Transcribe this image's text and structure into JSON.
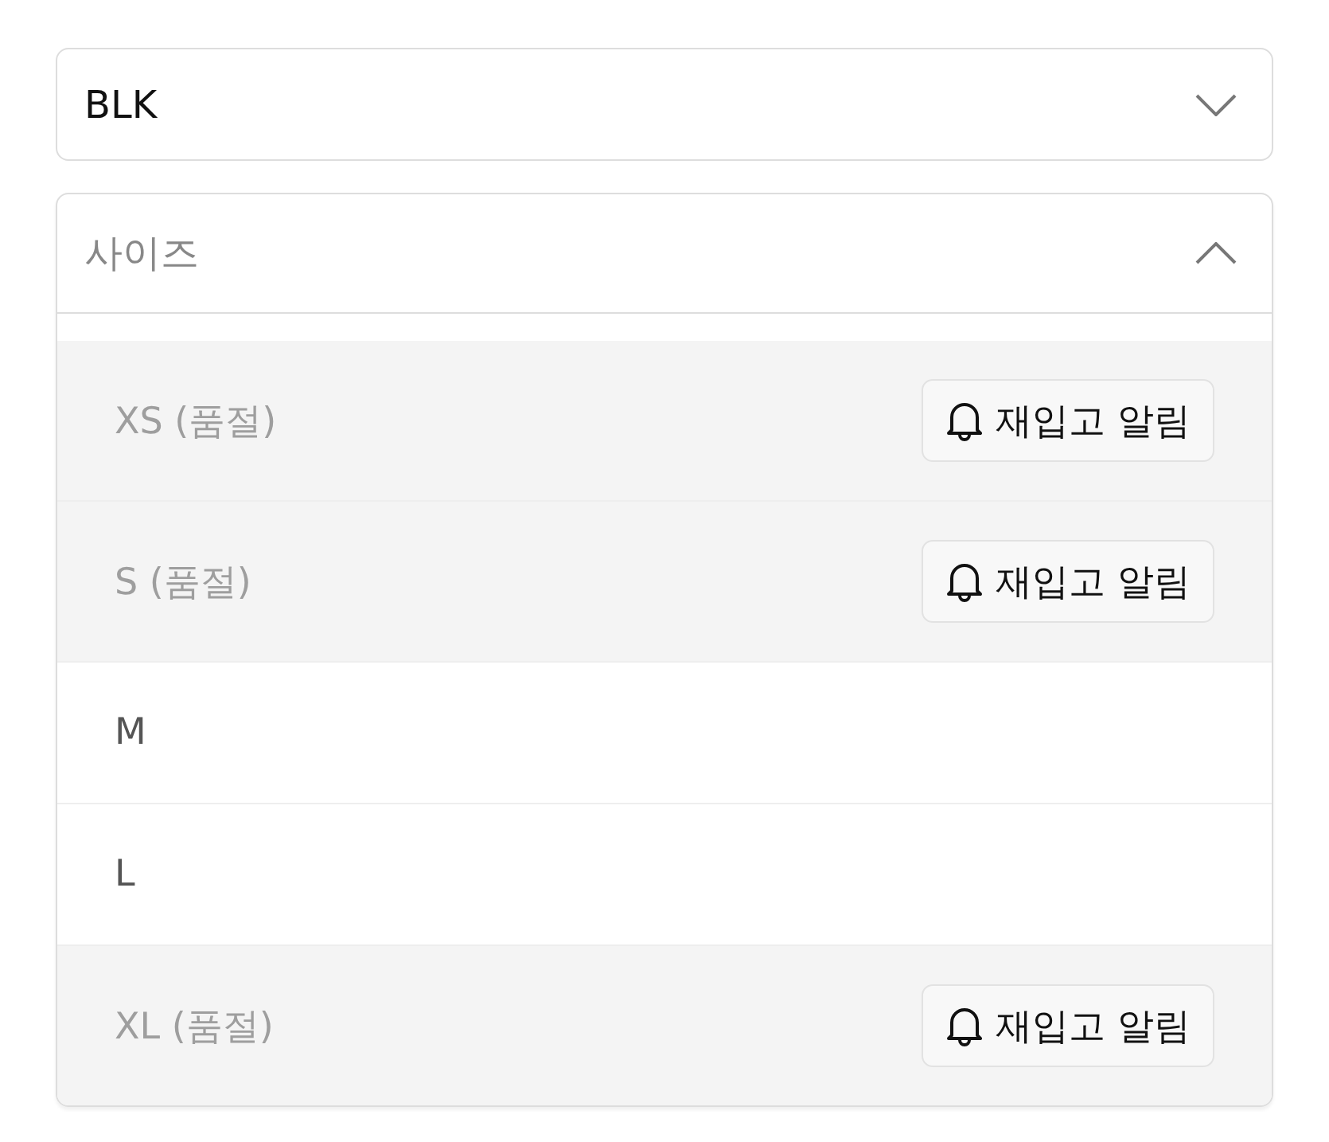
{
  "color_select": {
    "value": "BLK",
    "expanded": false
  },
  "size_select": {
    "placeholder": "사이즈",
    "expanded": true,
    "options": [
      {
        "label": "XS (품절)",
        "sold_out": true,
        "button": "재입고 알림"
      },
      {
        "label": "S (품절)",
        "sold_out": true,
        "button": "재입고 알림"
      },
      {
        "label": "M",
        "sold_out": false
      },
      {
        "label": "L",
        "sold_out": false
      },
      {
        "label": "XL (품절)",
        "sold_out": true,
        "button": "재입고 알림"
      }
    ]
  }
}
